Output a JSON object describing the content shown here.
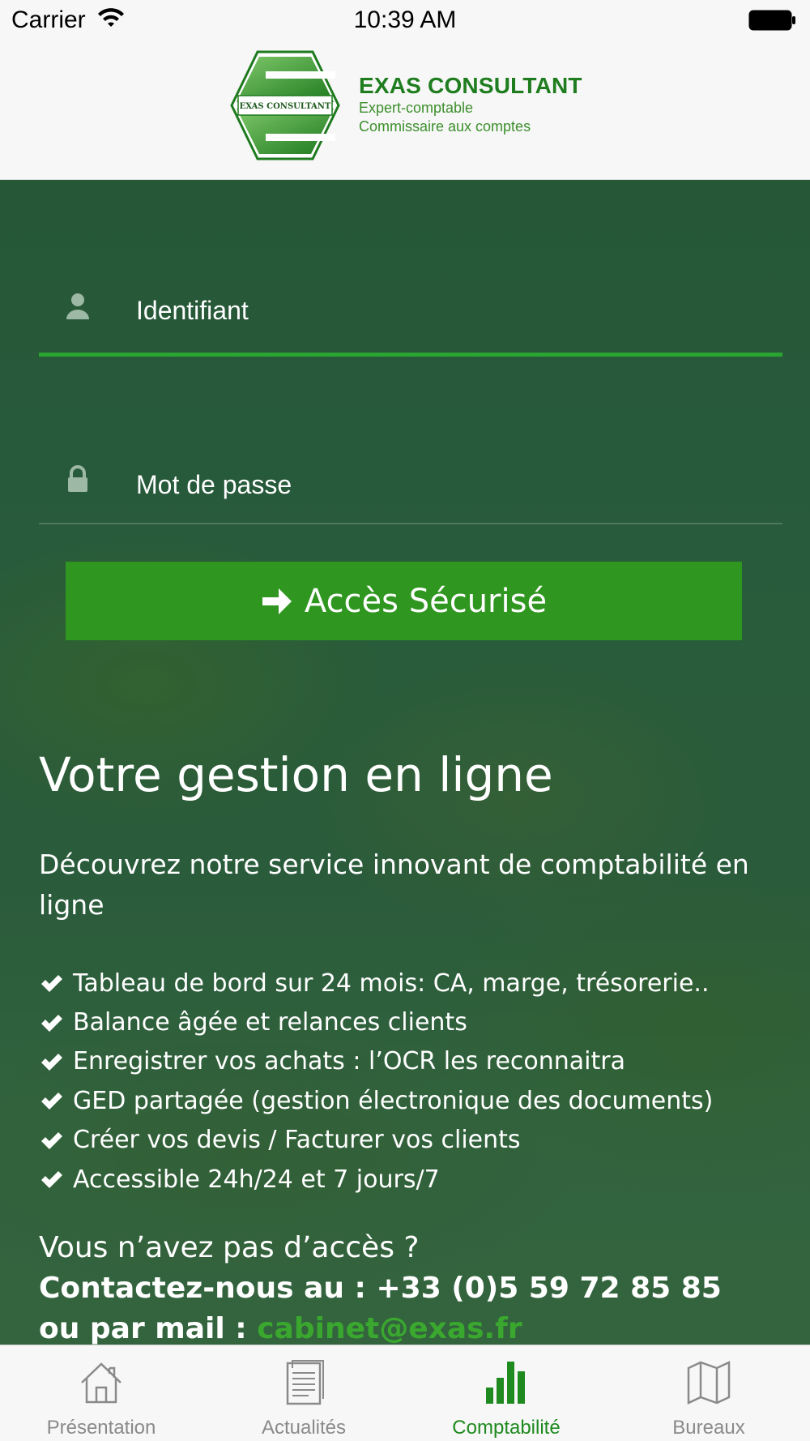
{
  "status": {
    "carrier": "Carrier",
    "time": "10:39 AM"
  },
  "header": {
    "logo_text": "EXAS CONSULTANT",
    "brand_name": "EXAS CONSULTANT",
    "brand_line1": "Expert-comptable",
    "brand_line2": "Commissaire aux comptes",
    "brand_color": "#1f7d1f"
  },
  "login": {
    "username_placeholder": "Identifiant",
    "username_icon": "user-icon",
    "password_placeholder": "Mot de passe",
    "password_icon": "lock-icon",
    "submit_label": "Accès Sécurisé",
    "submit_icon": "arrow-right-icon",
    "accent_color": "#2f9620"
  },
  "content": {
    "headline": "Votre gestion en ligne",
    "intro": "Découvrez notre service innovant de comptabilité en ligne",
    "features": [
      "Tableau de bord sur 24 mois: CA, marge, trésorerie..",
      "Balance âgée et relances clients",
      "Enregistrer vos achats : l’OCR les reconnaitra",
      "GED partagée (gestion électronique des documents)",
      "Créer vos devis / Facturer vos clients",
      "Accessible 24h/24 et 7 jours/7"
    ],
    "no_access": "Vous n’avez pas d’accès ?",
    "contact_phone_line": "Contactez-nous au : +33 (0)5 59 72 85 85",
    "contact_mail_prefix": "ou par mail : ",
    "contact_email": "cabinet@exas.fr"
  },
  "tabs": [
    {
      "label": "Présentation",
      "icon": "home-icon",
      "active": false
    },
    {
      "label": "Actualités",
      "icon": "news-icon",
      "active": false
    },
    {
      "label": "Comptabilité",
      "icon": "bar-chart-icon",
      "active": true
    },
    {
      "label": "Bureaux",
      "icon": "map-icon",
      "active": false
    }
  ]
}
